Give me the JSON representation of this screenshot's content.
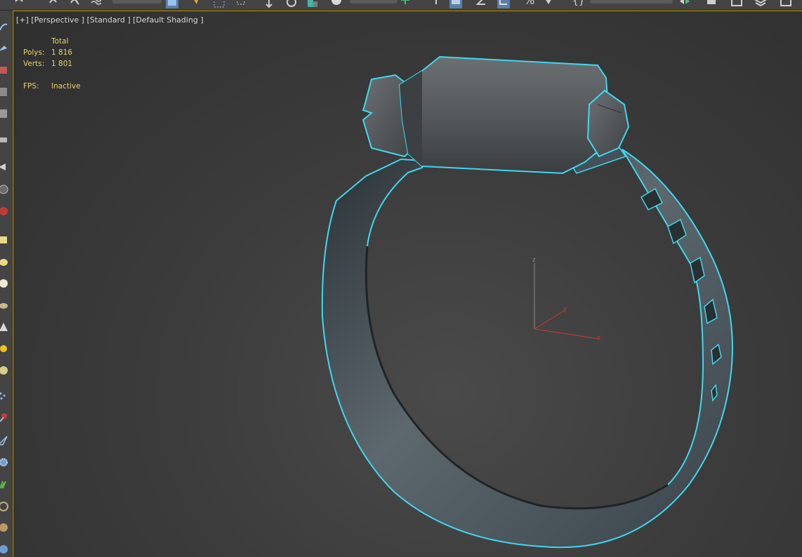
{
  "viewport": {
    "label_segments": [
      "[+]",
      "[Perspective ]",
      "[Standard ]",
      "[Default Shading ]"
    ]
  },
  "stats": {
    "header": "Total",
    "polys_label": "Polys:",
    "polys_value": "1 816",
    "verts_label": "Verts:",
    "verts_value": "1 801",
    "fps_label": "FPS:",
    "fps_value": "Inactive"
  },
  "axis_gizmo": {
    "z_label": "z",
    "y_label": "y",
    "x_label": "x"
  },
  "model": {
    "name": "hose clamp",
    "selection_outline_color": "#3fd8ee",
    "body_color": "#4f5a5f"
  },
  "colors": {
    "viewport_border_active": "#c8a000",
    "stats_text": "#e6d26a",
    "x_axis": "#c83a3a",
    "y_axis": "#c83a3a",
    "z_axis": "#8a8a8a"
  },
  "toolbar_icons": [
    "undo-icon",
    "redo-icon",
    "link-icon",
    "unlink-icon",
    "bind-space-warp-icon",
    "select-object-icon",
    "select-by-name-icon",
    "rectangular-selection-icon",
    "window-crossing-icon",
    "select-and-move-icon",
    "select-and-rotate-icon",
    "select-and-scale-icon",
    "snap-toggle-icon",
    "angle-snap-icon",
    "percent-snap-icon",
    "spinner-snap-icon",
    "curve-editor-icon",
    "schematic-view-icon"
  ],
  "left_toolbar_icons": [
    "paint-selection-icon",
    "brush-icon",
    "image-icon",
    "film-strip-icon",
    "grid-icon",
    "keyboard-icon",
    "pin-icon",
    "sphere-icon",
    "material-icon",
    "box-icon",
    "cylinder-icon",
    "torus-icon",
    "teapot-icon",
    "cone-icon",
    "light-icon",
    "camera-icon",
    "particles-icon",
    "helper-icon",
    "space-warp-icon",
    "gear-icon",
    "plant-icon",
    "shell-icon",
    "shell-alt-icon",
    "globe-icon"
  ]
}
